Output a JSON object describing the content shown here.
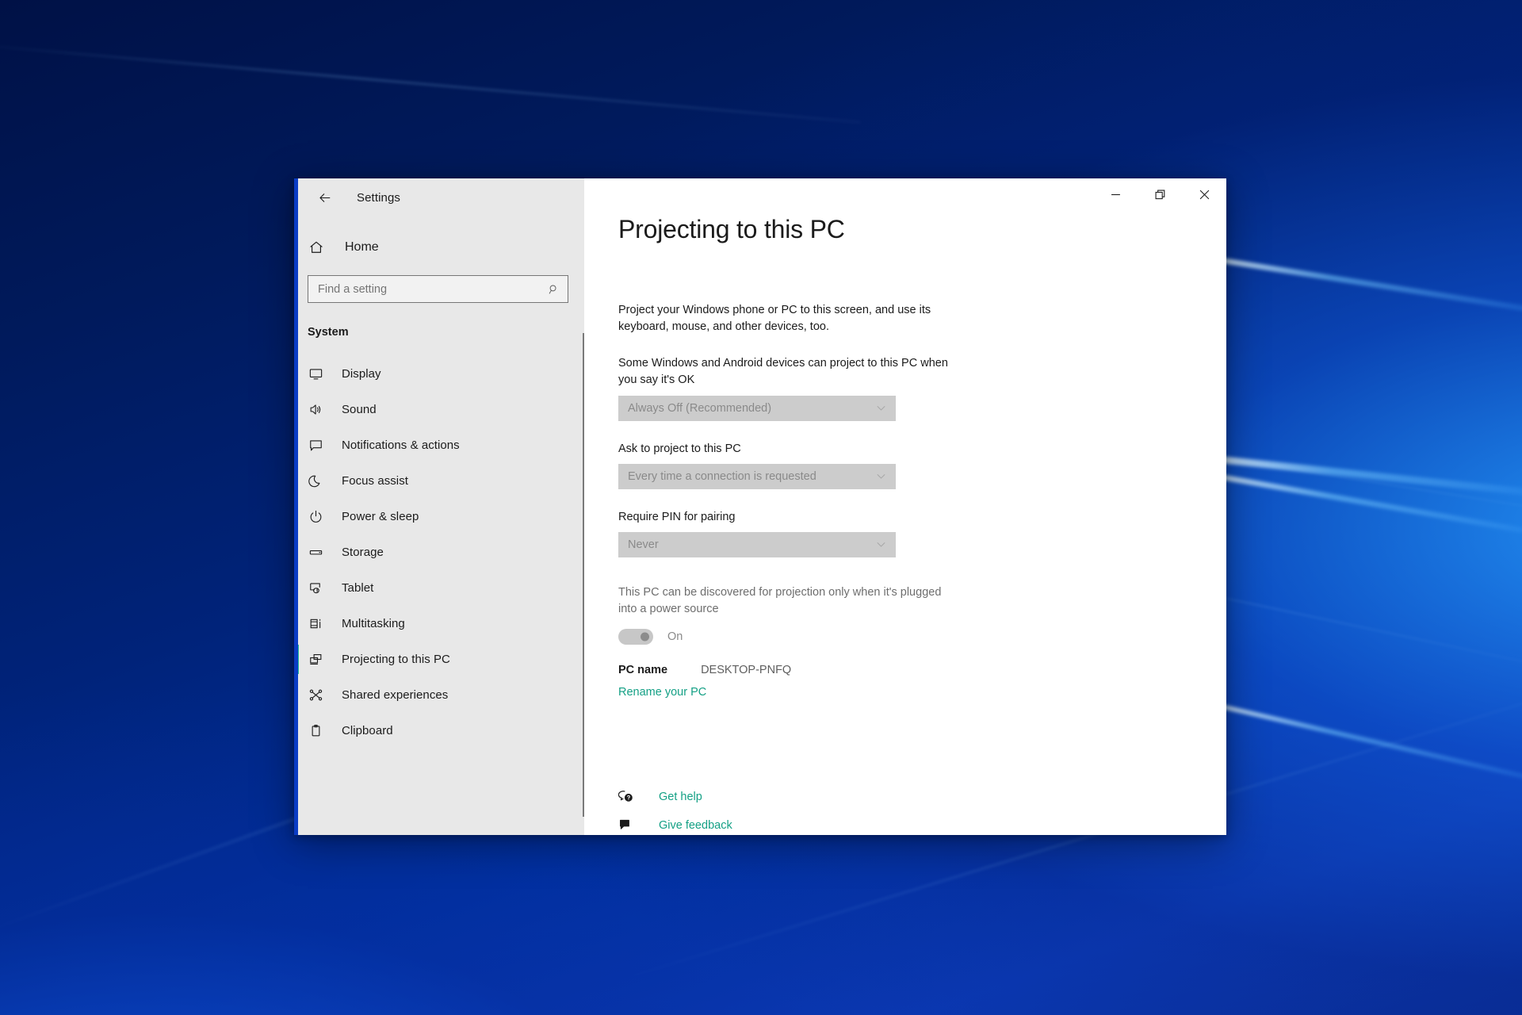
{
  "window": {
    "titlebar_label": "Settings",
    "back_icon": "back-arrow-icon",
    "controls": {
      "minimize": "minimize-icon",
      "restore": "restore-icon",
      "close": "close-icon"
    }
  },
  "sidebar": {
    "home": {
      "label": "Home",
      "icon": "home-icon"
    },
    "search": {
      "placeholder": "Find a setting",
      "value": "",
      "icon": "search-icon"
    },
    "section_heading": "System",
    "items": [
      {
        "label": "Display",
        "icon": "monitor-icon",
        "selected": false
      },
      {
        "label": "Sound",
        "icon": "speaker-icon",
        "selected": false
      },
      {
        "label": "Notifications & actions",
        "icon": "notification-icon",
        "selected": false
      },
      {
        "label": "Focus assist",
        "icon": "moon-icon",
        "selected": false
      },
      {
        "label": "Power & sleep",
        "icon": "power-icon",
        "selected": false
      },
      {
        "label": "Storage",
        "icon": "drive-icon",
        "selected": false
      },
      {
        "label": "Tablet",
        "icon": "tablet-icon",
        "selected": false
      },
      {
        "label": "Multitasking",
        "icon": "multitasking-icon",
        "selected": false
      },
      {
        "label": "Projecting to this PC",
        "icon": "project-icon",
        "selected": true
      },
      {
        "label": "Shared experiences",
        "icon": "share-icon",
        "selected": false
      },
      {
        "label": "Clipboard",
        "icon": "clipboard-icon",
        "selected": false
      }
    ]
  },
  "main": {
    "title": "Projecting to this PC",
    "intro": "Project your Windows phone or PC to this screen, and use its keyboard, mouse, and other devices, too.",
    "settings": [
      {
        "label": "Some Windows and Android devices can project to this PC when you say it's OK",
        "value": "Always Off (Recommended)",
        "disabled": true
      },
      {
        "label": "Ask to project to this PC",
        "value": "Every time a connection is requested",
        "disabled": true
      },
      {
        "label": "Require PIN for pairing",
        "value": "Never",
        "disabled": true
      }
    ],
    "power_setting": {
      "label": "This PC can be discovered for projection only when it's plugged into a power source",
      "toggle_state": "On",
      "disabled": true
    },
    "pc_name": {
      "key": "PC name",
      "value": "DESKTOP-PNFQ",
      "rename_link": "Rename your PC"
    },
    "footer_links": [
      {
        "label": "Get help",
        "icon": "help-bubbles-icon"
      },
      {
        "label": "Give feedback",
        "icon": "feedback-icon"
      }
    ]
  },
  "colors": {
    "accent_teal": "#14a085",
    "selection_bar": "#1fb89b",
    "window_border": "#0a3cc4",
    "sidebar_bg": "#e8e8e8",
    "disabled_control": "#cccccc"
  }
}
